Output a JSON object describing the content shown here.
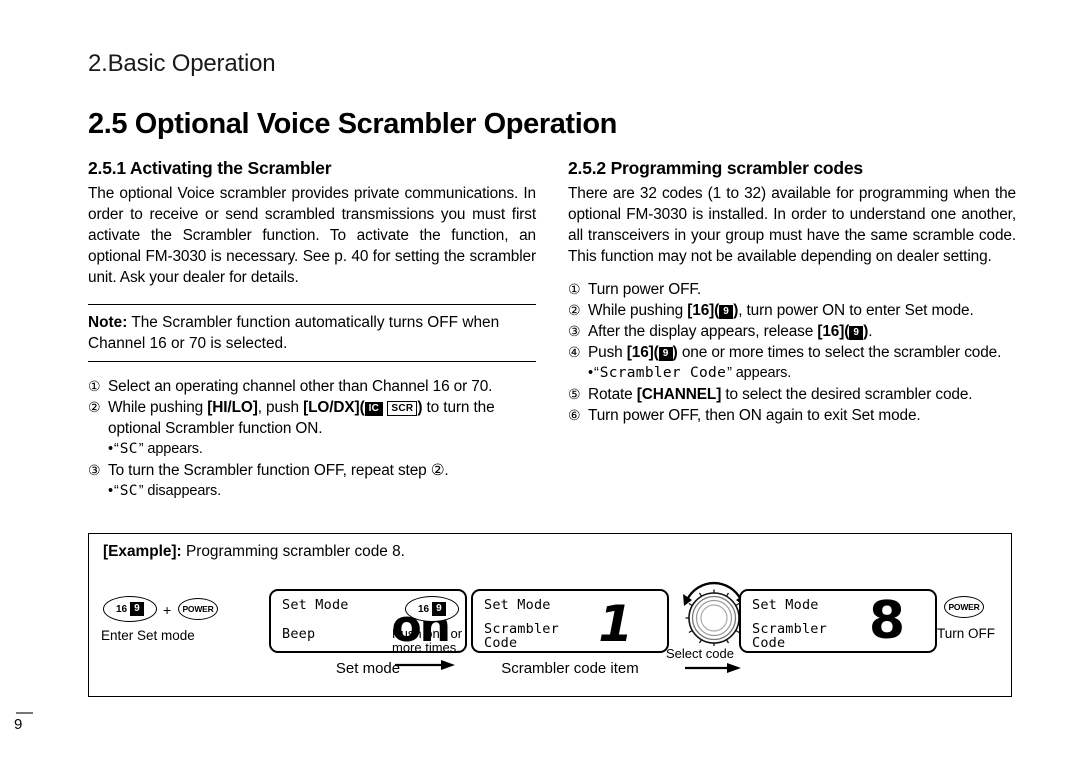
{
  "document": {
    "chapter_head": "2.Basic Operation",
    "section_title": "2.5 Optional Voice Scrambler Operation",
    "page_number": "9"
  },
  "left_column": {
    "sub_title": "2.5.1 Activating the Scrambler",
    "intro": "The optional Voice scrambler provides private communications. In order to receive or send scrambled transmissions you must first activate the Scrambler function. To activate the function, an optional FM-3030 is necessary. See p. 40 for setting the scrambler unit. Ask your dealer for details.",
    "note_label": "Note:",
    "note_text": "The Scrambler function automatically turns OFF when Channel 16 or 70 is selected.",
    "steps": [
      {
        "num": "①",
        "text": "Select an operating channel other than Channel 16 or 70."
      },
      {
        "num": "②",
        "pre": "While pushing ",
        "key1": "[HI/LO]",
        "mid": ", push ",
        "key2": "[LO/DX]",
        "paren_open": "(",
        "chip_ic": "IC",
        "chip_scr": "SCR",
        "paren_close": ")",
        "post": " to turn the optional Scrambler function ON.",
        "bullet": {
          "dot": "•",
          "q_open": "“",
          "lcd": "SC",
          "q_close": "”",
          "tail": " appears."
        }
      },
      {
        "num": "③",
        "text": "To turn the Scrambler function OFF, repeat step ②.",
        "bullet": {
          "dot": "•",
          "q_open": "“",
          "lcd": "SC",
          "q_close": "”",
          "tail": " disappears."
        }
      }
    ]
  },
  "right_column": {
    "sub_title": "2.5.2 Programming scrambler codes",
    "intro": "There are 32 codes (1 to 32) available for programming when the optional FM-3030 is installed. In order to understand one another, all transceivers in your group must have the same scramble code. This function may not be available depending on dealer setting.",
    "steps": [
      {
        "num": "①",
        "text": "Turn power OFF."
      },
      {
        "num": "②",
        "pre": "While pushing ",
        "key": "[16]",
        "chip": "9",
        "post": ", turn power ON to enter Set mode."
      },
      {
        "num": "③",
        "pre": "After the display appears, release ",
        "key": "[16]",
        "chip": "9",
        "post": "."
      },
      {
        "num": "④",
        "pre": "Push ",
        "key": "[16]",
        "chip": "9",
        "post": " one or more times to select the scrambler code.",
        "bullet": {
          "dot": "•",
          "q_open": "“",
          "lcd": "Scrambler Code",
          "q_close": "”",
          "tail": " appears."
        }
      },
      {
        "num": "⑤",
        "pre": "Rotate ",
        "key": "[CHANNEL]",
        "post": " to select the desired scrambler code."
      },
      {
        "num": "⑥",
        "text": "Turn power OFF, then ON again to exit Set mode."
      }
    ]
  },
  "example": {
    "title_label": "[Example]:",
    "title_text": " Programming scrambler code 8.",
    "step1": {
      "key_num": "16",
      "key_chip": "9",
      "plus": "+",
      "power_label": "POWER",
      "caption": "Enter Set mode"
    },
    "lcd1": {
      "line1": "Set Mode",
      "line2": "Beep",
      "value": "on",
      "caption": "Set mode"
    },
    "step2": {
      "key_num": "16",
      "key_chip": "9",
      "caption_line1": "Push one or",
      "caption_line2": "more times."
    },
    "lcd2": {
      "line1": "Set Mode",
      "line2": "Scrambler",
      "line3": "Code",
      "value": "1",
      "caption": "Scrambler code item"
    },
    "step3": {
      "caption": "Select code"
    },
    "lcd3": {
      "line1": "Set Mode",
      "line2": "Scrambler",
      "line3": "Code",
      "value": "8"
    },
    "step4": {
      "power_label": "POWER",
      "caption": "Turn OFF"
    }
  }
}
